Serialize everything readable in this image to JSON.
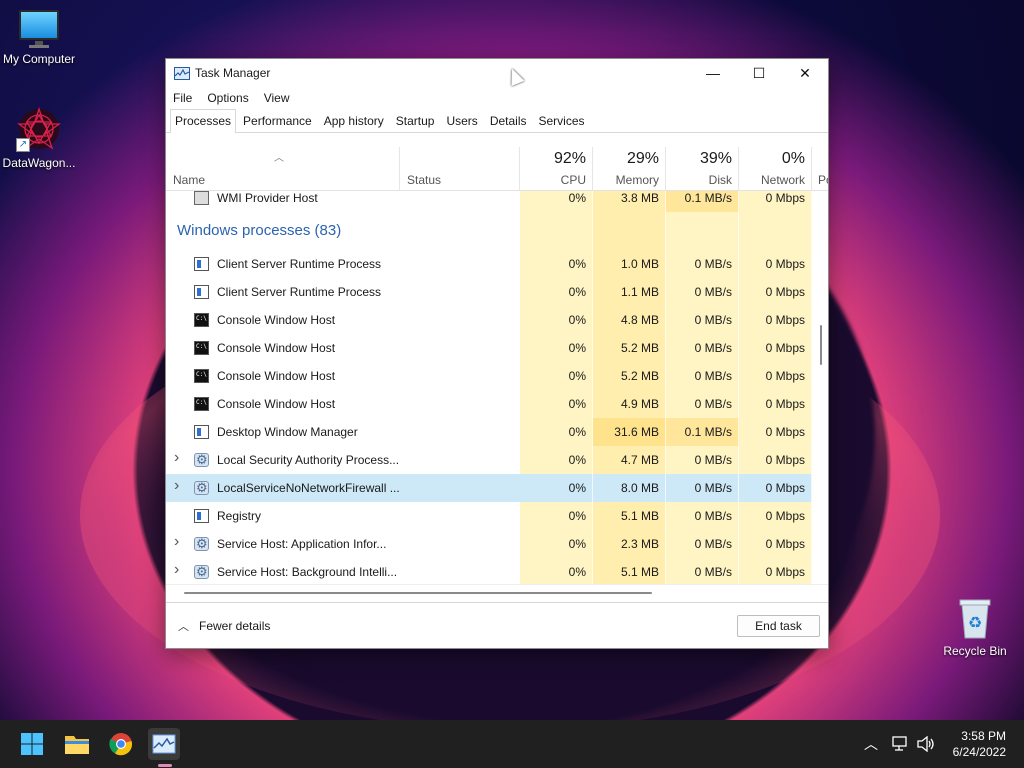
{
  "desktop": {
    "icons": [
      {
        "label": "My Computer",
        "icon": "computer-icon"
      },
      {
        "label": "DataWagon...",
        "icon": "datawagon-icon"
      },
      {
        "label": "Recycle Bin",
        "icon": "recycle-bin-icon"
      }
    ]
  },
  "window": {
    "title": "Task Manager",
    "controls": {
      "minimize": "—",
      "maximize": "☐",
      "close": "✕"
    },
    "menu": [
      "File",
      "Options",
      "View"
    ],
    "tabs": [
      "Processes",
      "Performance",
      "App history",
      "Startup",
      "Users",
      "Details",
      "Services"
    ],
    "active_tab": "Processes",
    "columns": {
      "name": "Name",
      "status": "Status",
      "cpu": {
        "percent": "92%",
        "label": "CPU"
      },
      "memory": {
        "percent": "29%",
        "label": "Memory"
      },
      "disk": {
        "percent": "39%",
        "label": "Disk"
      },
      "network": {
        "percent": "0%",
        "label": "Network"
      },
      "power": "Po"
    },
    "rows": [
      {
        "name": "WMI Provider Host",
        "icon": "wmi-icon",
        "cpu": "0%",
        "memory": "3.8 MB",
        "disk": "0.1 MB/s",
        "network": "0 Mbps"
      },
      {
        "group": "Windows processes (83)"
      },
      {
        "name": "Client Server Runtime Process",
        "icon": "app-icon",
        "cpu": "0%",
        "memory": "1.0 MB",
        "disk": "0 MB/s",
        "network": "0 Mbps"
      },
      {
        "name": "Client Server Runtime Process",
        "icon": "app-icon",
        "cpu": "0%",
        "memory": "1.1 MB",
        "disk": "0 MB/s",
        "network": "0 Mbps"
      },
      {
        "name": "Console Window Host",
        "icon": "console-icon",
        "cpu": "0%",
        "memory": "4.8 MB",
        "disk": "0 MB/s",
        "network": "0 Mbps"
      },
      {
        "name": "Console Window Host",
        "icon": "console-icon",
        "cpu": "0%",
        "memory": "5.2 MB",
        "disk": "0 MB/s",
        "network": "0 Mbps"
      },
      {
        "name": "Console Window Host",
        "icon": "console-icon",
        "cpu": "0%",
        "memory": "5.2 MB",
        "disk": "0 MB/s",
        "network": "0 Mbps"
      },
      {
        "name": "Console Window Host",
        "icon": "console-icon",
        "cpu": "0%",
        "memory": "4.9 MB",
        "disk": "0 MB/s",
        "network": "0 Mbps"
      },
      {
        "name": "Desktop Window Manager",
        "icon": "app-icon",
        "cpu": "0%",
        "memory": "31.6 MB",
        "disk": "0.1 MB/s",
        "network": "0 Mbps"
      },
      {
        "name": "Local Security Authority Process...",
        "icon": "gear-icon",
        "expandable": true,
        "cpu": "0%",
        "memory": "4.7 MB",
        "disk": "0 MB/s",
        "network": "0 Mbps"
      },
      {
        "name": "LocalServiceNoNetworkFirewall ...",
        "icon": "gear-icon",
        "expandable": true,
        "selected": true,
        "cpu": "0%",
        "memory": "8.0 MB",
        "disk": "0 MB/s",
        "network": "0 Mbps"
      },
      {
        "name": "Registry",
        "icon": "app-icon",
        "cpu": "0%",
        "memory": "5.1 MB",
        "disk": "0 MB/s",
        "network": "0 Mbps"
      },
      {
        "name": "Service Host: Application Infor...",
        "icon": "gear-icon",
        "expandable": true,
        "cpu": "0%",
        "memory": "2.3 MB",
        "disk": "0 MB/s",
        "network": "0 Mbps"
      },
      {
        "name": "Service Host: Background Intelli...",
        "icon": "gear-icon",
        "expandable": true,
        "cpu": "0%",
        "memory": "5.1 MB",
        "disk": "0 MB/s",
        "network": "0 Mbps"
      }
    ],
    "footer": {
      "fewer_details": "Fewer details",
      "end_task": "End task"
    }
  },
  "taskbar": {
    "apps": [
      "start-icon",
      "file-explorer-icon",
      "chrome-icon",
      "task-manager-icon"
    ],
    "clock": {
      "time": "3:58 PM",
      "date": "6/24/2022"
    }
  },
  "colors": {
    "selection": "#cde8f7",
    "heat_light": "#fff4c4",
    "heat_medium": "#ffeeae",
    "group_title": "#2a64b0",
    "taskbar": "#202020"
  }
}
